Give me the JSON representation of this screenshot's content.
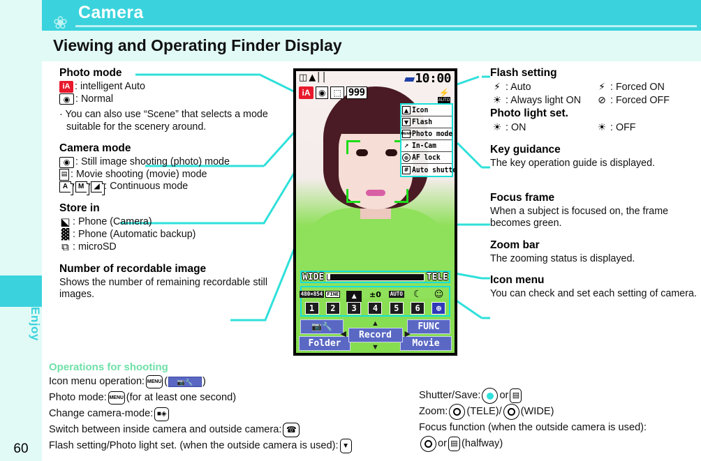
{
  "sidebar": {
    "tab_label": "Enjoy",
    "page_number": "60"
  },
  "header": {
    "title": "Camera",
    "flower_icon": "flower-icon"
  },
  "subtitle": {
    "text": "Viewing and Operating Finder Display"
  },
  "left_column": {
    "photo_mode": {
      "heading": "Photo mode",
      "items": [
        {
          "icon": "intelligent-auto-icon",
          "glyph": "iA",
          "label": ": intelligent Auto"
        },
        {
          "icon": "camera-normal-icon",
          "glyph": "◉",
          "label": ": Normal"
        }
      ],
      "note": "· You can also use “Scene” that selects a mode suitable for the scenery around."
    },
    "camera_mode": {
      "heading": "Camera mode",
      "items": [
        {
          "icon": "still-camera-icon",
          "glyph": "📷",
          "label": ": Still image shooting (photo) mode"
        },
        {
          "icon": "movie-film-icon",
          "glyph": "☰",
          "label": ": Movie shooting (movie) mode"
        },
        {
          "icon": "continuous-mode-icons",
          "glyph": "A",
          "glyph2": "M",
          "glyph3": "⬛",
          "label": ": Continuous mode",
          "sep": "/"
        }
      ]
    },
    "store_in": {
      "heading": "Store in",
      "items": [
        {
          "icon": "phone-camera-storage-icon",
          "glyph": "⬓",
          "label": ": Phone (Camera)"
        },
        {
          "icon": "phone-auto-backup-icon",
          "glyph": "▓",
          "label": ": Phone (Automatic backup)"
        },
        {
          "icon": "microsd-icon",
          "glyph": "⧉",
          "label": ": microSD"
        }
      ]
    },
    "recordable": {
      "heading": "Number of recordable image",
      "body": "Shows the number of remaining recordable still images."
    }
  },
  "right_column": {
    "flash_setting": {
      "heading": "Flash setting",
      "items": [
        {
          "icon": "flash-auto-icon",
          "glyph": "⚡",
          "label": ": Auto"
        },
        {
          "icon": "flash-forced-on-icon",
          "glyph": "⚡",
          "label": ": Forced ON"
        },
        {
          "icon": "always-light-on-icon",
          "glyph": "≡◐",
          "label": ": Always light ON"
        },
        {
          "icon": "flash-forced-off-icon",
          "glyph": "⊘",
          "label": ": Forced OFF"
        }
      ]
    },
    "photo_light": {
      "heading": "Photo light set.",
      "items": [
        {
          "icon": "photo-light-on-icon",
          "glyph": "≡◐",
          "label": ": ON"
        },
        {
          "icon": "photo-light-off-icon",
          "glyph": "≡◐",
          "label": ": OFF"
        }
      ]
    },
    "key_guidance": {
      "heading": "Key guidance",
      "body": "The key operation guide is displayed."
    },
    "focus_frame": {
      "heading": "Focus frame",
      "body": "When a subject is focused on, the frame becomes green."
    },
    "zoom_bar": {
      "heading": "Zoom bar",
      "body": "The zooming status is displayed."
    },
    "icon_menu": {
      "heading": "Icon menu",
      "body": "You can check and set each setting of camera."
    }
  },
  "phone_screen": {
    "clock": "10:00",
    "status_icons": [
      "battery-icon",
      "signal-icon"
    ],
    "mail_icon": "mail-icon",
    "flash_indicator": {
      "icon": "flash-auto-icon",
      "label": "AUTO"
    },
    "mode_badges": {
      "photo_mode": "iA",
      "camera_mode_icon": "still-camera-icon",
      "store_in_icon": "phone-camera-storage-icon",
      "recordable_count": "999"
    },
    "key_guidance_rows": [
      {
        "key": "▲",
        "label": "Icon"
      },
      {
        "key": "▼",
        "label": "Flash"
      },
      {
        "key": "MENU",
        "label": "Photo mode"
      },
      {
        "key": "↗",
        "label": "In-Cam"
      },
      {
        "key": "⊕",
        "label": "AF lock"
      },
      {
        "key": "#",
        "label": "Auto shutter"
      }
    ],
    "zoom_bar": {
      "left_label": "WIDE",
      "right_label": "TELE",
      "position_percent": 2
    },
    "icon_menu": [
      {
        "num": "1",
        "top": "480×854",
        "type": "resolution"
      },
      {
        "num": "2",
        "top": "FINE",
        "type": "quality"
      },
      {
        "num": "3",
        "top": "scene-off-icon",
        "type": "icon"
      },
      {
        "num": "4",
        "top": "±0",
        "type": "brightness"
      },
      {
        "num": "5",
        "top": "AUTO",
        "type": "whitebalance"
      },
      {
        "num": "6",
        "top": "effect-icon",
        "type": "icon"
      },
      {
        "num": "⊕",
        "top": "smile-detect-icon",
        "type": "icon"
      }
    ],
    "softkeys": {
      "top_left": "camera-settings-icon",
      "bottom_left": "Folder",
      "center": "Record",
      "top_right": "FUNC",
      "bottom_right": "Movie"
    }
  },
  "operations": {
    "title": "Operations for shooting",
    "left": [
      {
        "text_before": "Icon menu operation: ",
        "key": "MENU",
        "text_after": "(",
        "swatch": "camera-settings-icon",
        "text_end": ")"
      },
      {
        "text_before": "Photo mode: ",
        "key": "MENU",
        "text_after": "(for at least one second)"
      },
      {
        "text_before": "Change camera-mode: ",
        "key": "camera-mode-key"
      },
      {
        "text_before": "Switch between inside camera and outside camera: ",
        "key": "call-key"
      },
      {
        "text_before": "Flash setting/Photo light set. (when the outside camera is used): ",
        "key": "down-key"
      }
    ],
    "right": [
      {
        "text_before": "Shutter/Save: ",
        "key1": "center-key",
        "mid": " or ",
        "key2": "side-key"
      },
      {
        "text_before": "Zoom: ",
        "key1": "left-key",
        "mid": "(TELE)/",
        "key2": "right-key",
        "text_after": "(WIDE)"
      },
      {
        "text_before": "Focus function (when the outside camera is used):"
      },
      {
        "key1": "down-half-key",
        "mid": " or ",
        "key2": "side-key",
        "text_after": "(halfway)"
      }
    ]
  },
  "colors": {
    "accent": "#3ad3dd",
    "accent_light": "#e1faf6",
    "connector": "#2fe0da",
    "ops_title": "#6fe0a8",
    "focus_green": "#1ddc18",
    "ia_red": "#e8192c",
    "softkey_blue": "#5a68c4"
  }
}
